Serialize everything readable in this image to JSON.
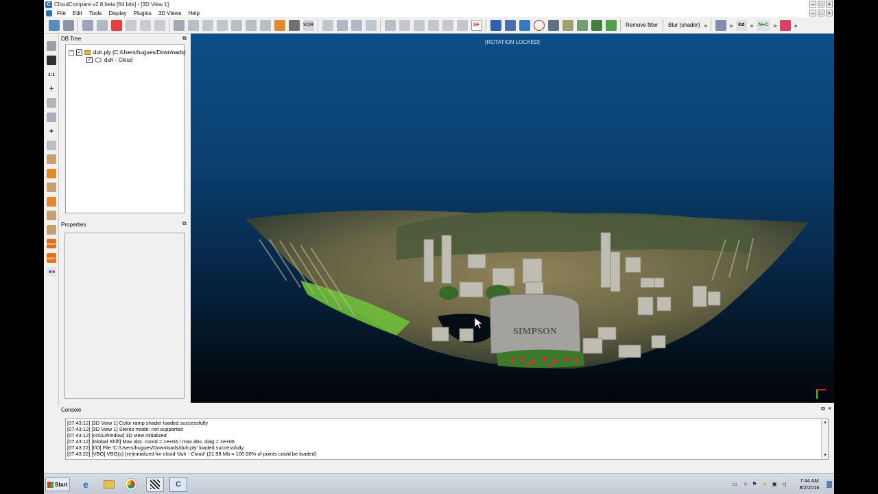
{
  "window": {
    "title": "CloudCompare v2.8.beta [64 bits] - [3D View 1]",
    "app_icon_letter": "C"
  },
  "menu": [
    {
      "label": "File"
    },
    {
      "label": "Edit"
    },
    {
      "label": "Tools"
    },
    {
      "label": "Display"
    },
    {
      "label": "Plugins"
    },
    {
      "label": "3D Views"
    },
    {
      "label": "Help"
    }
  ],
  "toolbar": {
    "sf_label": "SF",
    "sor_label": "SOR",
    "remove_filter": "Remove filter",
    "blur_shader": "Blur (shader)",
    "more": "»",
    "kd_label": "Kd",
    "nc_label": "N+C"
  },
  "side_toolbar": {
    "one_to_one": "1:1",
    "front": "FRONT",
    "back": "BACK"
  },
  "db_tree": {
    "title": "DB Tree",
    "items": [
      {
        "label": "duh.ply (C:/Users/hugues/Downloads)"
      },
      {
        "label": "duh - Cloud"
      }
    ]
  },
  "properties": {
    "title": "Properties"
  },
  "view3d": {
    "status": "[ROTATION LOCKED]",
    "headstone_text": "SIMPSON",
    "colors": {
      "sky_top": "#0d4f88",
      "ground": "#8a7a50",
      "grass": "#6fbf3a"
    }
  },
  "console": {
    "title": "Console",
    "lines": [
      "[07:43:12] [3D View 1] Color ramp shader loaded successfully",
      "[07:43:12] [3D View 1] Stereo mode: not supported",
      "[07:43:12] [ccGLWindow] 3D view initialized",
      "[07:43:12] [Global Shift] Max abs. coord = 1e+04 / max abs. diag = 1e+06",
      "[07:43:22] [I/O] File 'C:/Users/hugues/Downloads/duh.ply' loaded successfully",
      "[07:43:22] [VBO] VBO(s) (re)initialized for cloud 'duh - Cloud' (21.98 Mb = 100.00% of points could be loaded)"
    ]
  },
  "taskbar": {
    "start": "Start",
    "cc_letter": "C",
    "clock_time": "7:44 AM",
    "clock_date": "8/2/2016"
  }
}
